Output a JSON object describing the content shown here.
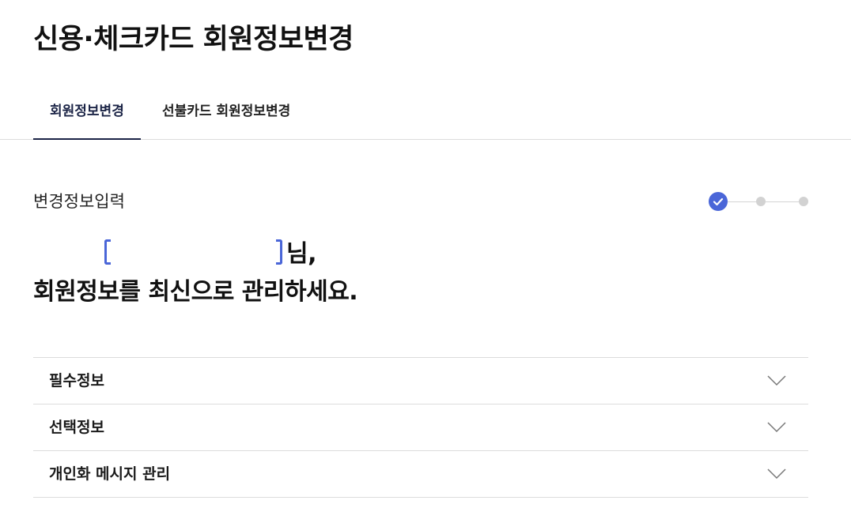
{
  "page": {
    "title": "신용·체크카드 회원정보변경"
  },
  "tabs": [
    {
      "label": "회원정보변경",
      "active": true
    },
    {
      "label": "선불카드 회원정보변경",
      "active": false
    }
  ],
  "section": {
    "title": "변경정보입력"
  },
  "stepper": {
    "current_step": 1,
    "total_steps": 3
  },
  "greeting": {
    "name_value": "",
    "honorific": "님,",
    "message": "회원정보를 최신으로 관리하세요."
  },
  "accordion": [
    {
      "label": "필수정보",
      "icon": "chevron-down-icon"
    },
    {
      "label": "선택정보",
      "icon": "chevron-down-icon"
    },
    {
      "label": "개인화 메시지 관리",
      "icon": "chevron-down-icon"
    }
  ],
  "colors": {
    "accent": "#4a66d8",
    "tab_active": "#1b2446",
    "divider": "#dcdcdc",
    "inactive_step": "#d2d2d2"
  }
}
